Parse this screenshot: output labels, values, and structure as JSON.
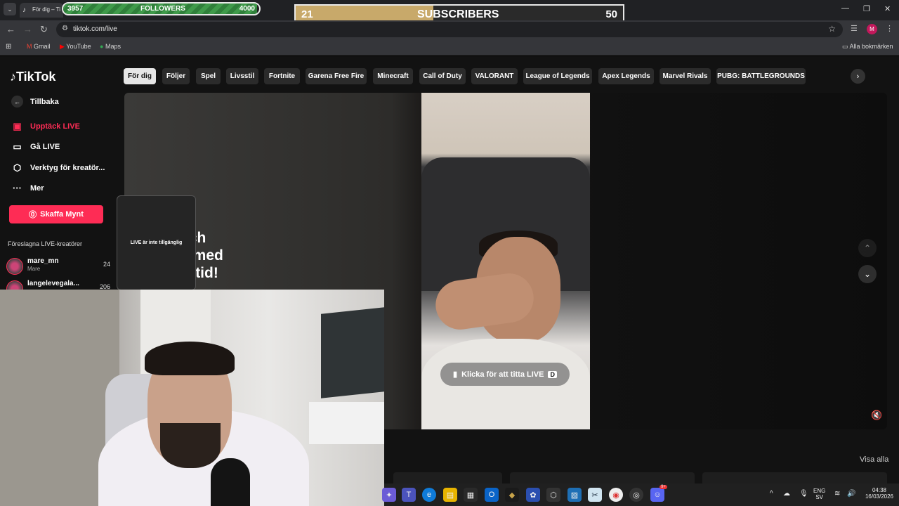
{
  "browser": {
    "tab_title": "För dig – Ti",
    "url": "tiktok.com/live",
    "bookmarks": [
      "Gmail",
      "YouTube",
      "Maps"
    ],
    "all_bookmarks": "Alla bokmärken",
    "profile_initial": "M"
  },
  "overlays": {
    "followers": {
      "current": "3957",
      "label": "FOLLOWERS",
      "goal": "4000",
      "progress": 0.99
    },
    "subscribers": {
      "current": "21",
      "label": "SUBSCRIBERS",
      "goal": "50",
      "progress": 0.42
    }
  },
  "tiktok": {
    "logo": "TikTok",
    "sidebar": {
      "back": "Tillbaka",
      "items": [
        "Upptäck LIVE",
        "Gå LIVE",
        "Verktyg för kreatör...",
        "Mer"
      ],
      "coins_button": "Skaffa Mynt",
      "suggested_title": "Föreslagna LIVE-kreatörer",
      "creators": [
        {
          "name": "mare_mn",
          "sub": "Mare",
          "count": "24"
        },
        {
          "name": "langelevegala...",
          "sub": "",
          "count": "206"
        }
      ]
    },
    "categories": [
      "För dig",
      "Följer",
      "Spel",
      "Livsstil",
      "Fortnite",
      "Garena Free Fire",
      "Minecraft",
      "Call of Duty",
      "VALORANT",
      "League of Legends",
      "Apex Legends",
      "Marvel Rivals",
      "PUBG: BATTLEGROUNDS"
    ],
    "hero": {
      "text_lines": [
        "och",
        "ra med",
        "ealtid!"
      ],
      "watch_button": "Klicka för att titta LIVE",
      "watch_key": "D"
    },
    "unavailable": "LIVE är inte tillgänglig",
    "see_all": "Visa alla"
  },
  "taskbar": {
    "lang": "ENG",
    "lang_sub": "SV",
    "time": "04:38",
    "date": "16/03/2026",
    "discord_badge": "9+"
  },
  "colors": {
    "accent": "#fe2c55",
    "followers_fill": "#3f9a4a",
    "subs_fill": "#c8a96a"
  }
}
